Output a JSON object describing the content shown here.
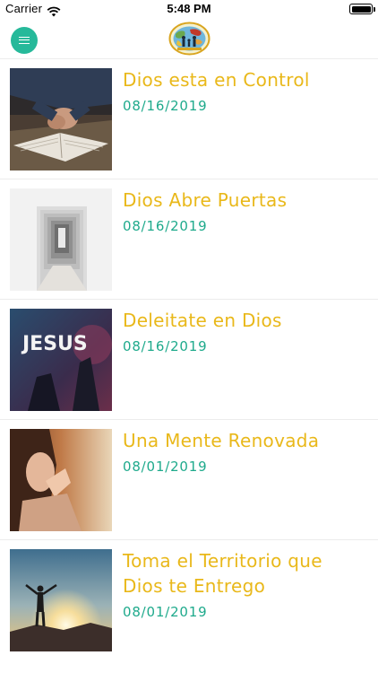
{
  "status_bar": {
    "carrier": "Carrier",
    "time": "5:48 PM",
    "wifi_icon": "wifi-icon",
    "battery_icon": "battery-icon",
    "battery_level": 1.0
  },
  "nav": {
    "menu_icon": "hamburger-menu-icon",
    "logo": "church-family-globe-logo",
    "accent_color": "#26b99a"
  },
  "colors": {
    "title": "#e9b81a",
    "date": "#1faa8c"
  },
  "items": [
    {
      "title": "Dios esta en Control",
      "date": "08/16/2019",
      "image": "hands-praying-on-bible"
    },
    {
      "title": "Dios Abre Puertas",
      "date": "08/16/2019",
      "image": "open-doors-corridor"
    },
    {
      "title": "Deleitate en Dios",
      "date": "08/16/2019",
      "image": "jesus-worship-stage",
      "image_text": "JESUS"
    },
    {
      "title": "Una Mente Renovada",
      "date": "08/01/2019",
      "image": "woman-praying"
    },
    {
      "title": "Toma el Territorio que Dios te Entrego",
      "date": "08/01/2019",
      "image": "man-arms-open-sunset"
    }
  ]
}
